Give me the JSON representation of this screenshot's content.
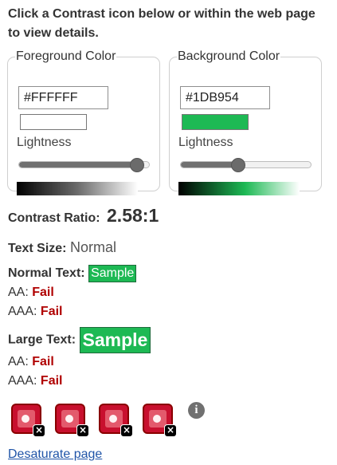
{
  "instructions": "Click a Contrast icon below or within the web page to view details.",
  "foreground": {
    "legend": "Foreground Color",
    "hex": "#FFFFFF",
    "swatch_color": "#FFFFFF",
    "lightness_label": "Lightness",
    "lightness_value": 0.9
  },
  "background": {
    "legend": "Background Color",
    "hex": "#1DB954",
    "swatch_color": "#1DB954",
    "lightness_label": "Lightness",
    "lightness_value": 0.44
  },
  "contrast": {
    "label": "Contrast Ratio:",
    "value": "2.58:1"
  },
  "text_size": {
    "label": "Text Size:",
    "value": "Normal"
  },
  "normal_text": {
    "label": "Normal Text:",
    "sample": "Sample",
    "aa_label": "AA:",
    "aa_result": "Fail",
    "aaa_label": "AAA:",
    "aaa_result": "Fail"
  },
  "large_text": {
    "label": "Large Text:",
    "sample": "Sample",
    "aa_label": "AA:",
    "aa_result": "Fail",
    "aaa_label": "AAA:",
    "aaa_result": "Fail"
  },
  "icons": [
    {
      "name": "contrast-error-icon",
      "badge": "×"
    },
    {
      "name": "contrast-error-icon",
      "badge": "×"
    },
    {
      "name": "contrast-error-icon",
      "badge": "×"
    },
    {
      "name": "contrast-error-icon",
      "badge": "×"
    }
  ],
  "info_icon": "i",
  "desaturate_link": "Desaturate page",
  "colors": {
    "sample_bg": "#1DB954",
    "sample_fg": "#FFFFFF",
    "fail": "#B00000",
    "link": "#2155A8"
  }
}
